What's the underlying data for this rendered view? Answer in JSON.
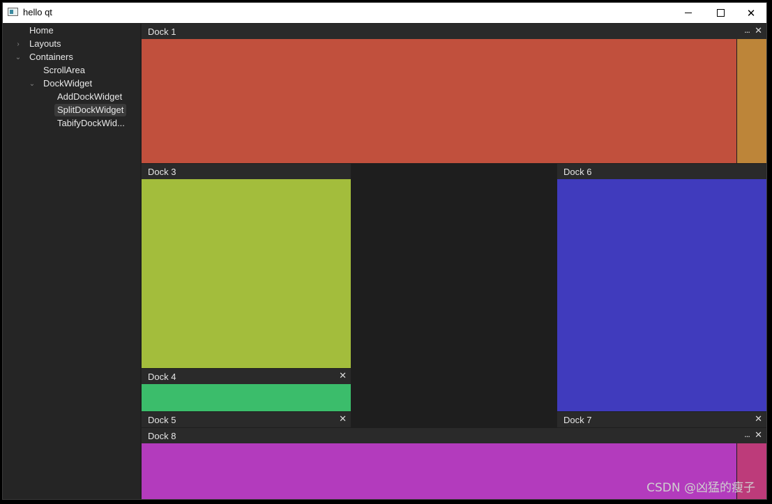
{
  "window": {
    "title": "hello qt"
  },
  "tree": {
    "items": [
      {
        "label": "Home"
      },
      {
        "label": "Layouts"
      },
      {
        "label": "Containers"
      },
      {
        "label": "ScrollArea"
      },
      {
        "label": "DockWidget"
      },
      {
        "label": "AddDockWidget"
      },
      {
        "label": "SplitDockWidget"
      },
      {
        "label": "TabifyDockWid..."
      }
    ]
  },
  "docks": {
    "dock1": {
      "title": "Dock 1",
      "more": "...",
      "close": "✕",
      "color": "#c1503d",
      "side_color": "#bd8539"
    },
    "dock3": {
      "title": "Dock 3",
      "color": "#a3bd3c"
    },
    "dock4": {
      "title": "Dock 4",
      "close": "✕",
      "color": "#3bbd6b"
    },
    "dock5": {
      "title": "Dock 5",
      "close": "✕"
    },
    "dock6": {
      "title": "Dock 6",
      "color": "#403bbd"
    },
    "dock7": {
      "title": "Dock 7",
      "close": "✕"
    },
    "dock8": {
      "title": "Dock 8",
      "more": "...",
      "close": "✕",
      "color": "#b33bbd",
      "side_color": "#bd3b7a"
    }
  },
  "watermark": "CSDN @凶猛的瘦子"
}
